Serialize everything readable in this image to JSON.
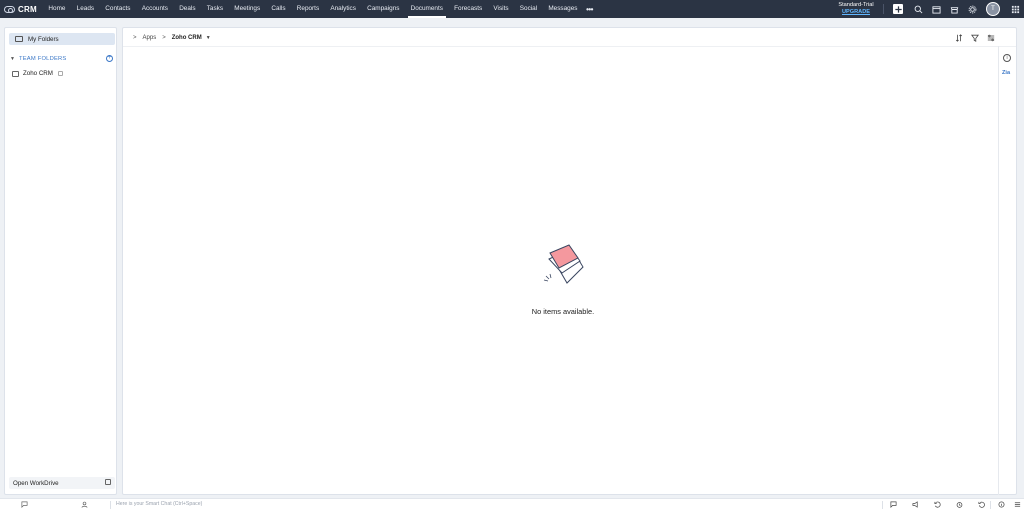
{
  "app": {
    "brand": "CRM"
  },
  "nav": {
    "tabs": [
      {
        "label": "Home"
      },
      {
        "label": "Leads"
      },
      {
        "label": "Contacts"
      },
      {
        "label": "Accounts"
      },
      {
        "label": "Deals"
      },
      {
        "label": "Tasks"
      },
      {
        "label": "Meetings"
      },
      {
        "label": "Calls"
      },
      {
        "label": "Reports"
      },
      {
        "label": "Analytics"
      },
      {
        "label": "Campaigns"
      },
      {
        "label": "Documents",
        "active": true
      },
      {
        "label": "Forecasts"
      },
      {
        "label": "Visits"
      },
      {
        "label": "Social"
      },
      {
        "label": "Messages"
      }
    ],
    "more": "•••",
    "plan": "Standard-Trial",
    "upgrade": "UPGRADE",
    "avatar_initial": "T"
  },
  "sidebar": {
    "my_folders": "My Folders",
    "team_folders": "TEAM FOLDERS",
    "add_symbol": "+",
    "items": [
      {
        "label": "Zoho CRM"
      }
    ],
    "open_workdrive": "Open WorkDrive"
  },
  "main": {
    "breadcrumb": {
      "root": "Apps",
      "current": "Zoho CRM"
    },
    "empty_message": "No items available.",
    "rail": {
      "info": "i",
      "zia": "Zia"
    }
  },
  "bottom": {
    "smart_chat_placeholder": "Here is your Smart Chat (Ctrl+Space)"
  },
  "colors": {
    "nav_bg": "#2b3444",
    "accent": "#3c78c7",
    "upgrade": "#5fb6ff",
    "empty_illustration": "#f4989e"
  }
}
